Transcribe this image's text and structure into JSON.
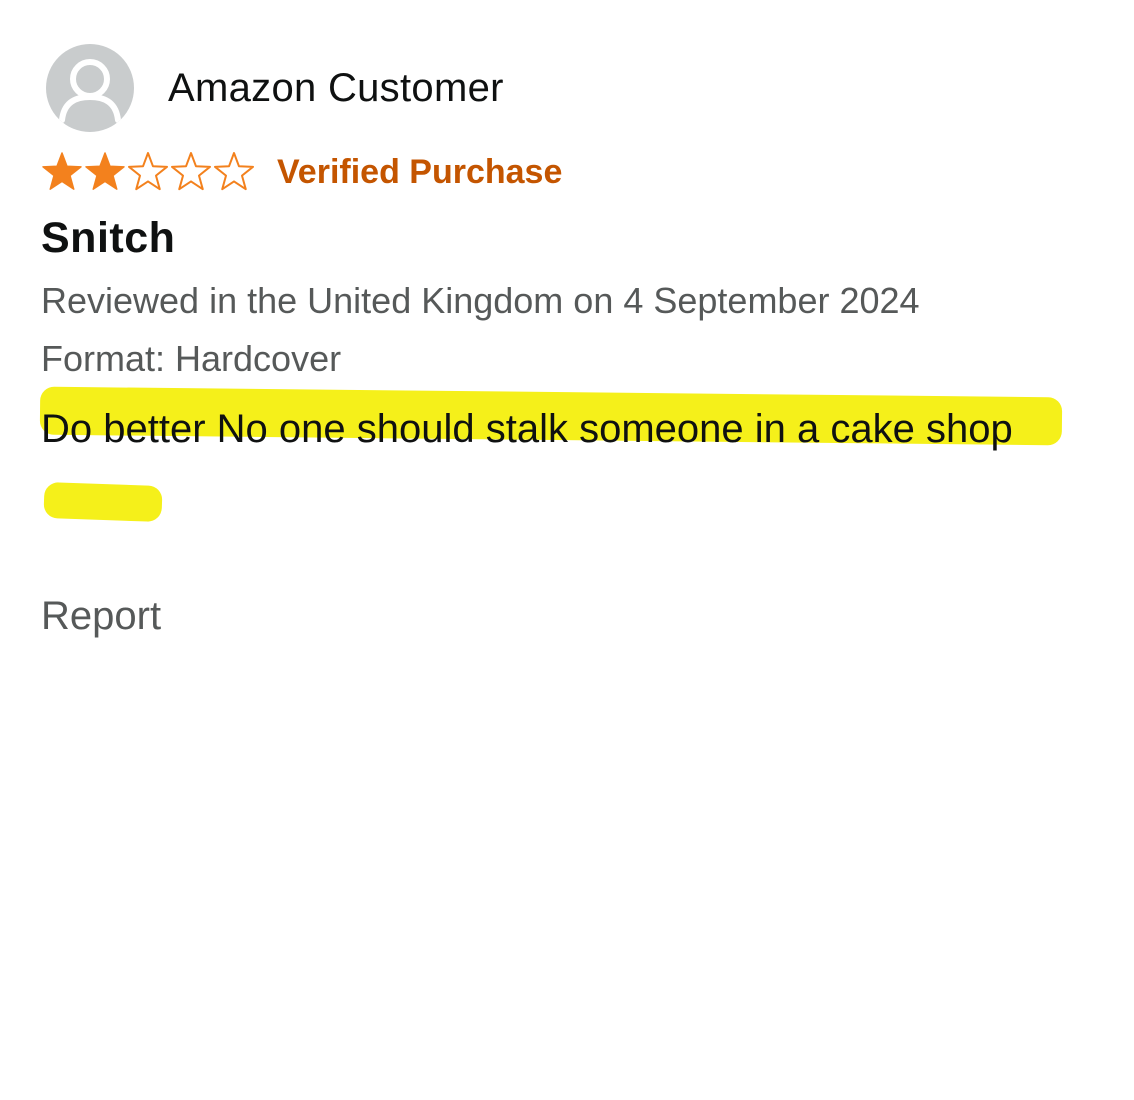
{
  "review": {
    "profile_name": "Amazon Customer",
    "rating": {
      "value": 2,
      "max": 5
    },
    "verified_label": "Verified Purchase",
    "title": "Snitch",
    "reviewed_line": "Reviewed in the United Kingdom on 4 September 2024",
    "format_line": "Format: Hardcover",
    "body": "Do better No one should stalk someone in a cake shop",
    "report_label": "Report"
  },
  "colors": {
    "star_filled": "#f3811d",
    "star_empty_outline": "#f3811d",
    "verified": "#c45500",
    "highlight": "#f5f01a",
    "avatar_bg": "#c9cccd",
    "avatar_figure": "#ffffff"
  },
  "icons": {
    "avatar": "user-silhouette-icon",
    "star_filled": "star-filled-icon",
    "star_empty": "star-outline-icon"
  }
}
